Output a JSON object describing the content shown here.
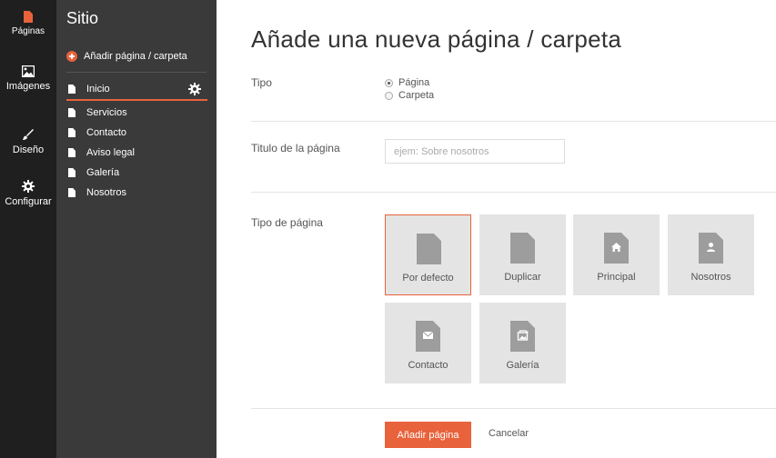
{
  "nav": {
    "items": [
      {
        "label": "Páginas",
        "icon": "file-icon"
      },
      {
        "label": "Imágenes",
        "icon": "image-icon"
      },
      {
        "label": "Diseño",
        "icon": "brush-icon"
      },
      {
        "label": "Configurar",
        "icon": "gear-icon"
      }
    ],
    "accent": "#e8623c"
  },
  "site": {
    "title": "Sitio",
    "add_label": "Añadir página / carpeta",
    "pages": [
      "Inicio",
      "Servicios",
      "Contacto",
      "Aviso legal",
      "Galería",
      "Nosotros"
    ],
    "active_page": "Inicio"
  },
  "main": {
    "title": "Añade una nueva página / carpeta",
    "tipo": {
      "label": "Tipo",
      "options": [
        "Página",
        "Carpeta"
      ],
      "selected": "Página"
    },
    "titulo": {
      "label": "Titulo de la página",
      "placeholder": "ejem: Sobre nosotros",
      "value": ""
    },
    "tipo_pagina": {
      "label": "Tipo de página",
      "tiles": [
        {
          "label": "Por defecto",
          "icon": "document-icon"
        },
        {
          "label": "Duplicar",
          "icon": "document-icon"
        },
        {
          "label": "Principal",
          "icon": "home-icon"
        },
        {
          "label": "Nosotros",
          "icon": "person-icon"
        },
        {
          "label": "Contacto",
          "icon": "envelope-icon"
        },
        {
          "label": "Galería",
          "icon": "gallery-icon"
        }
      ],
      "selected": "Por defecto"
    },
    "actions": {
      "submit_label": "Añadir página",
      "cancel_label": "Cancelar"
    }
  }
}
